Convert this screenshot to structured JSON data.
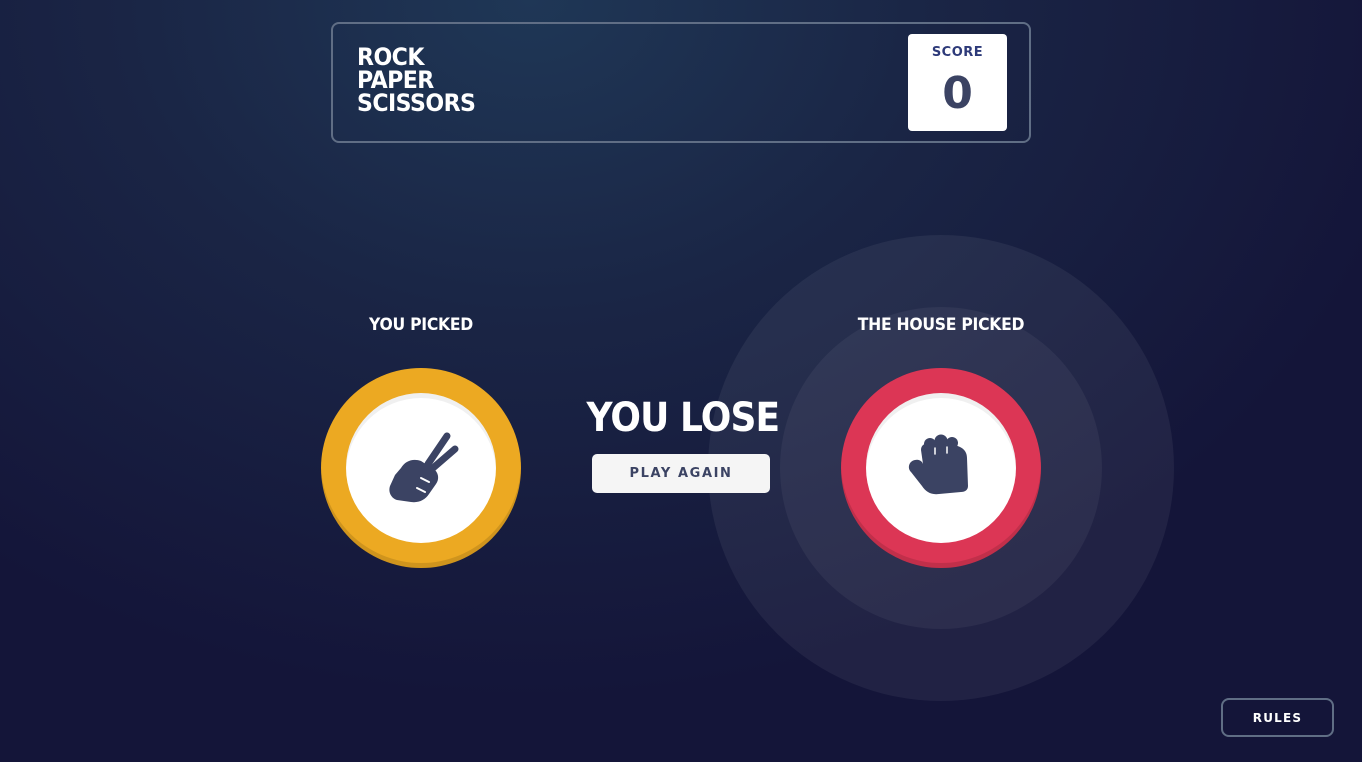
{
  "header": {
    "title_lines": [
      "ROCK",
      "PAPER",
      "SCISSORS"
    ],
    "score_label": "SCORE",
    "score_value": "0"
  },
  "player": {
    "label": "YOU PICKED",
    "choice": "scissors",
    "icon": "scissors-hand-icon",
    "ring_color": "#eca922"
  },
  "house": {
    "label": "THE HOUSE PICKED",
    "choice": "rock",
    "icon": "rock-fist-icon",
    "ring_color": "#dc3655",
    "is_winner": true
  },
  "result": {
    "text": "YOU LOSE",
    "play_again_label": "PLAY AGAIN"
  },
  "footer": {
    "rules_label": "RULES"
  },
  "colors": {
    "icon_fill": "#3b4363",
    "header_border": "#606e85"
  }
}
